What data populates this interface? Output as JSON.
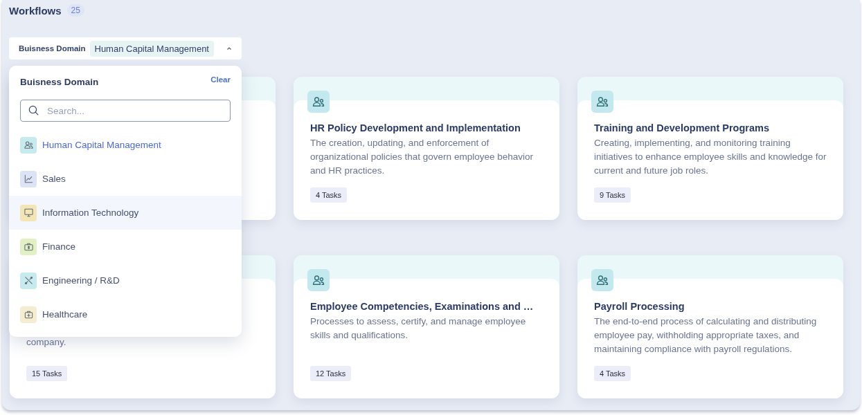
{
  "header": {
    "title": "Workflows",
    "count": "25"
  },
  "filter": {
    "label": "Buisness Domain",
    "value": "Human Capital Management",
    "expanded": true
  },
  "dropdown": {
    "title": "Buisness Domain",
    "clear": "Clear",
    "search": {
      "placeholder": "Search..."
    },
    "items": [
      {
        "label": "Human Capital Management",
        "selected": true,
        "highlighted": false,
        "color": "#c6eaee"
      },
      {
        "label": "Sales",
        "selected": false,
        "highlighted": false,
        "color": "#dde3f7"
      },
      {
        "label": "Information Technology",
        "selected": false,
        "highlighted": true,
        "color": "#f3e5b5"
      },
      {
        "label": "Finance",
        "selected": false,
        "highlighted": false,
        "color": "#e2f1c4"
      },
      {
        "label": "Engineering / R&D",
        "selected": false,
        "highlighted": false,
        "color": "#c6eaee"
      },
      {
        "label": "Healthcare",
        "selected": false,
        "highlighted": false,
        "color": "#f6ecd0"
      }
    ]
  },
  "cards": [
    {
      "kind": "covered"
    },
    {
      "kind": "full",
      "title": "HR Policy Development and Implementation",
      "description": "The creation, updating, and enforcement of organizational policies that govern employee behavior and HR practices.",
      "tasks": "4 Tasks"
    },
    {
      "kind": "full",
      "title": "Training and Development Programs",
      "description": "Creating, implementing, and monitoring training initiatives to enhance employee skills and knowledge for current and future job roles.",
      "tasks": "9 Tasks"
    },
    {
      "kind": "covered",
      "description": "company.",
      "tasks": "15 Tasks"
    },
    {
      "kind": "full",
      "title": "Employee Competencies, Examinations and …",
      "description": "Processes to assess, certify, and manage employee skills and qualifications.",
      "tasks": "12 Tasks"
    },
    {
      "kind": "full",
      "title": "Payroll Processing",
      "description": "The end-to-end process of calculating and distributing employee pay, withholding appropriate taxes, and maintaining compliance with payroll regulations.",
      "tasks": "4 Tasks"
    }
  ]
}
